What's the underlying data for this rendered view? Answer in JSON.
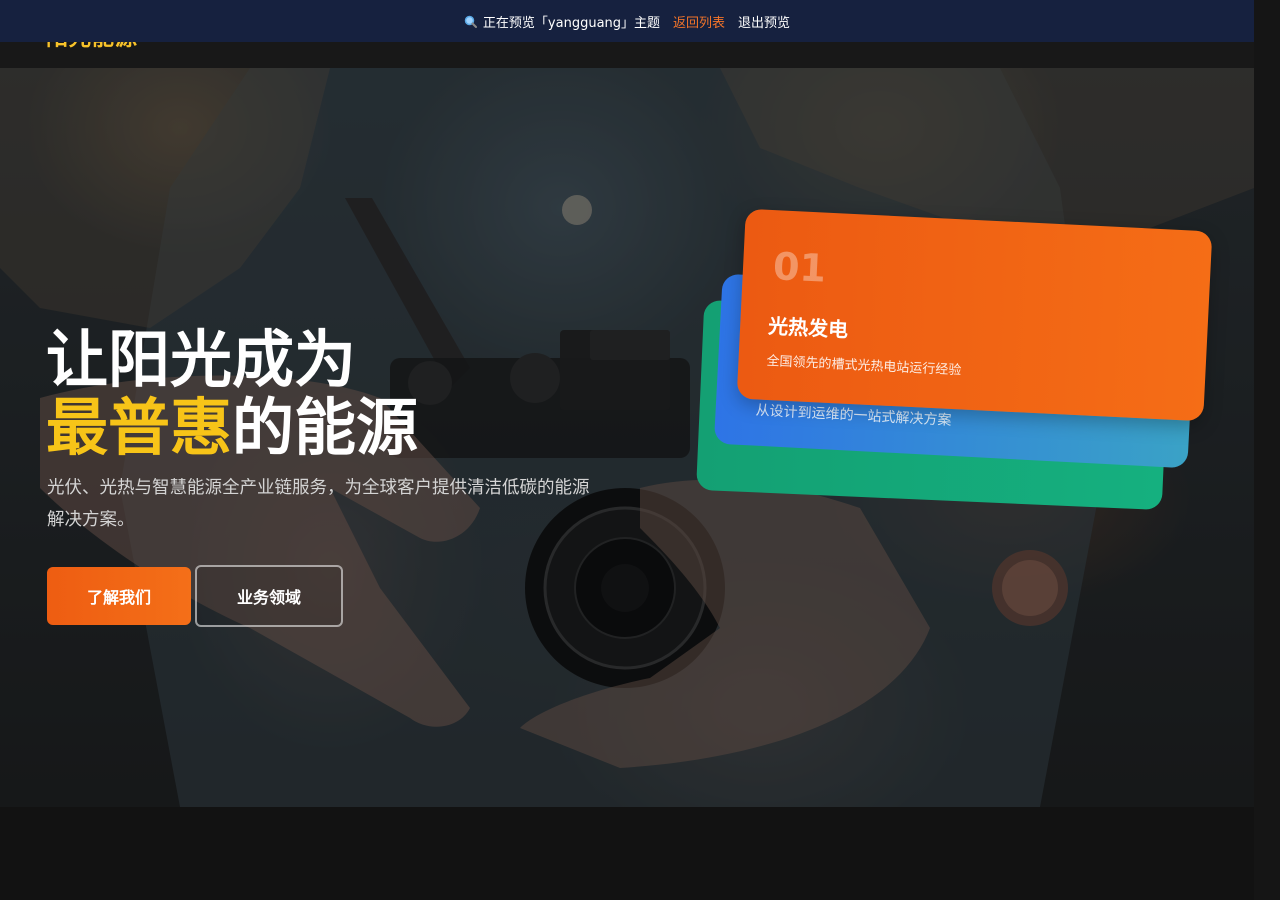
{
  "preview_bar": {
    "prefix": "正在预览「yangguang」主题",
    "back_label": "返回列表",
    "exit_label": "退出预览"
  },
  "header": {
    "logo_text": "阳光能源"
  },
  "hero": {
    "title_line1": "让阳光成为",
    "title_accent": "最普惠",
    "title_rest": "的能源",
    "subtitle": "光伏、光热与智慧能源全产业链服务，为全球客户提供清洁低碳的能源解决方案。",
    "primary_button": "了解我们",
    "secondary_button": "业务领域"
  },
  "cards": [
    {
      "number": "01",
      "title": "光热发电",
      "desc": "全国领先的槽式光热电站运行经验"
    },
    {
      "desc": "从设计到运维的一站式解决方案"
    }
  ],
  "colors": {
    "accent_yellow": "#f7c418",
    "accent_orange": "#f2742a",
    "card_orange": "#f56d16",
    "card_blue": "#2e74e6",
    "card_green": "#15b07f",
    "preview_bar_bg": "#16213f"
  },
  "icons": {
    "preview": "magnifier-icon"
  }
}
